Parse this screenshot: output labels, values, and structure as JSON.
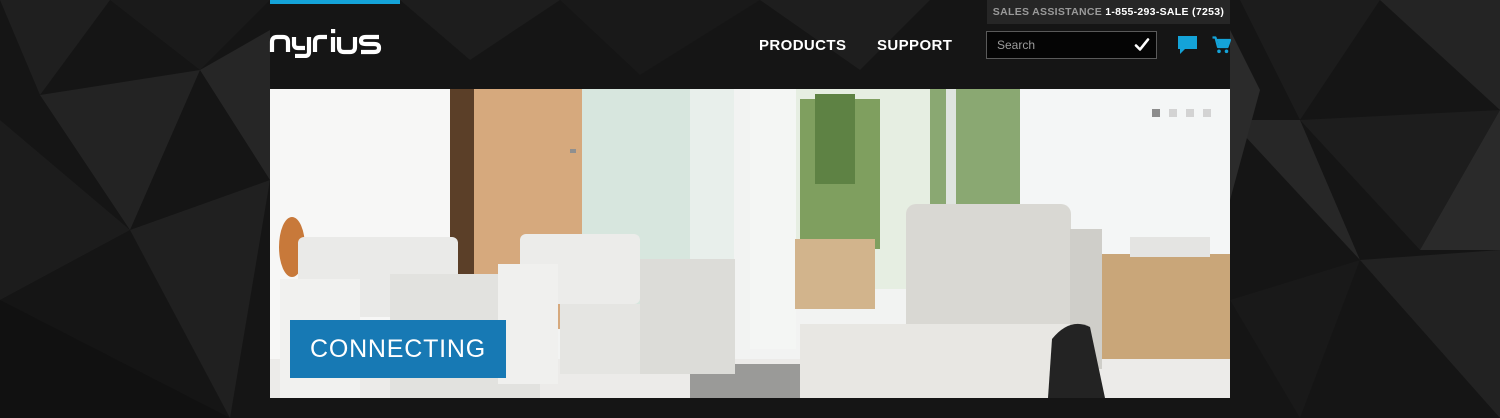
{
  "header": {
    "logo": "nyrius",
    "sales": {
      "label": "SALES ASSISTANCE",
      "phone": "1-855-293-SALE (7253)"
    },
    "nav": {
      "products": "PRODUCTS",
      "support": "SUPPORT"
    },
    "search": {
      "placeholder": "Search",
      "value": ""
    },
    "icons": {
      "search_submit": "checkmark-icon",
      "chat": "chat-bubble-icon",
      "cart": "shopping-cart-icon"
    }
  },
  "hero": {
    "caption": "CONNECTING",
    "slides_total": 4,
    "active_slide": 1
  },
  "colors": {
    "accent": "#14a3d8",
    "caption_bg": "#1779b4",
    "background": "#141414"
  }
}
